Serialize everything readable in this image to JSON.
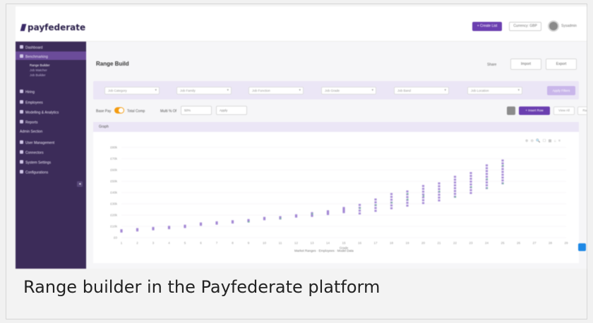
{
  "caption": "Range builder in the Payfederate platform",
  "topbar": {
    "logo_text": "payfederate",
    "create_button": "+ Create List",
    "currency_label": "Currency: GBP",
    "user_name": "Sysadmin"
  },
  "sidebar": {
    "items": [
      {
        "label": "Dashboard",
        "icon": "dashboard-icon"
      },
      {
        "label": "Benchmarking",
        "icon": "chart-icon",
        "active": true
      },
      {
        "label": "Hiring",
        "icon": "briefcase-icon"
      },
      {
        "label": "Employees",
        "icon": "people-icon"
      },
      {
        "label": "Modelling & Analytics",
        "icon": "analytics-icon"
      },
      {
        "label": "Reports",
        "icon": "report-icon"
      },
      {
        "label": "Admin Section",
        "icon": ""
      },
      {
        "label": "User Management",
        "icon": "user-icon"
      },
      {
        "label": "Connectors",
        "icon": "link-icon"
      },
      {
        "label": "System Settings",
        "icon": "gear-icon"
      },
      {
        "label": "Configurations",
        "icon": "sliders-icon"
      }
    ],
    "subitems": [
      "Range Builder",
      "Job Matcher",
      "Job Builder"
    ]
  },
  "main": {
    "title": "Range Build",
    "share_link": "Share",
    "import_button": "Import",
    "export_button": "Export",
    "filters": [
      "Job Category",
      "Job Family",
      "Job Function",
      "Job Grade",
      "Job Band",
      "Job Location"
    ],
    "apply_button": "Apply Filters",
    "base_pay_label": "Base Pay",
    "total_comp_label": "Total Comp",
    "multi_label": "Multi % Of",
    "multi_value": "50%",
    "multi_placeholder": "Apply",
    "insert_button": "+ Insert Row",
    "view_button": "View All",
    "range_button": "Range All",
    "columns_label": "Columns",
    "graph_header": "Graph",
    "chart_tools": "⊕ ⊖ 🔍 ☐ ▦ ⌂ ≡"
  },
  "chart_data": {
    "type": "scatter",
    "title": "",
    "xlabel": "Grade",
    "ylabel": "",
    "x_ticks": [
      "1",
      "2",
      "3",
      "4",
      "5",
      "6",
      "7",
      "8",
      "9",
      "10",
      "11",
      "12",
      "13",
      "14",
      "15",
      "16",
      "17",
      "18",
      "19",
      "20",
      "21",
      "22",
      "23",
      "24",
      "25",
      "26",
      "27",
      "28",
      "29"
    ],
    "y_ticks": [
      "£0",
      "£10k",
      "£20k",
      "£30k",
      "£40k",
      "£50k",
      "£60k",
      "£70k",
      "£80k"
    ],
    "ylim": [
      0,
      80000
    ],
    "legend": [
      "Market Ranges",
      "Employees",
      "Model Data"
    ],
    "colors": {
      "market": "#9a7bd0",
      "employees": "#7bc4a0",
      "model": "#b59ae0"
    },
    "series": [
      {
        "name": "Market Ranges",
        "points": [
          [
            1,
            6000
          ],
          [
            2,
            7000
          ],
          [
            3,
            8000
          ],
          [
            4,
            9000
          ],
          [
            5,
            10000
          ],
          [
            6,
            12000
          ],
          [
            7,
            13000
          ],
          [
            8,
            14000
          ],
          [
            9,
            15000
          ],
          [
            10,
            17000
          ],
          [
            11,
            18000
          ],
          [
            12,
            20000
          ],
          [
            13,
            21000
          ],
          [
            14,
            23000
          ],
          [
            15,
            25000
          ],
          [
            16,
            27000
          ],
          [
            17,
            30000
          ],
          [
            18,
            33000
          ],
          [
            19,
            36000
          ],
          [
            20,
            39000
          ],
          [
            21,
            42000
          ],
          [
            22,
            46000
          ],
          [
            23,
            50000
          ],
          [
            24,
            55000
          ],
          [
            25,
            60000
          ]
        ]
      },
      {
        "name": "Employees",
        "points": [
          [
            9,
            14000
          ],
          [
            11,
            17000
          ],
          [
            13,
            21000
          ],
          [
            16,
            26000
          ],
          [
            17,
            29000
          ],
          [
            18,
            31000
          ],
          [
            19,
            34000
          ],
          [
            19,
            39000
          ],
          [
            20,
            37000
          ],
          [
            21,
            41000
          ],
          [
            22,
            36000
          ],
          [
            23,
            45000
          ],
          [
            24,
            44000
          ],
          [
            24,
            52000
          ],
          [
            25,
            48000
          ],
          [
            25,
            64000
          ]
        ]
      }
    ]
  }
}
